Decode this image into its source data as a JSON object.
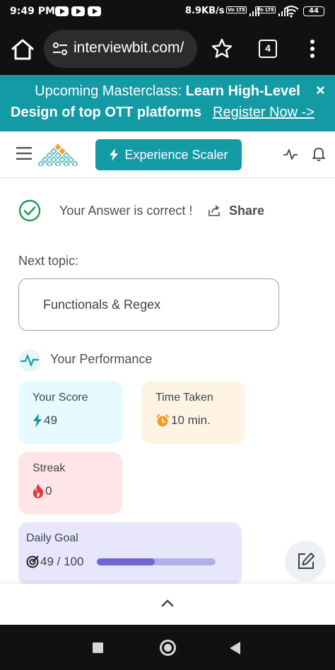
{
  "status_bar": {
    "time": "9:49 PM",
    "network_speed": "8.9KB/s",
    "sim1_tag": "Vo LTE",
    "sim2_tag": "Vo LTE",
    "battery": "44"
  },
  "browser": {
    "url": "interviewbit.com/",
    "tab_count": "4"
  },
  "banner": {
    "prefix": "Upcoming Masterclass: ",
    "highlight_1": "Learn High-Level",
    "highlight_2": "Design of top OTT platforms",
    "link_text": "Register Now ->",
    "close": "×",
    "background": "#139aa5"
  },
  "header": {
    "cta_label": "Experience Scaler",
    "accent": "#129aa5"
  },
  "result": {
    "message": "Your Answer is correct !",
    "share_label": "Share",
    "status_color": "#1f9d55"
  },
  "next_topic": {
    "label": "Next topic:",
    "title": "Functionals & Regex"
  },
  "performance": {
    "title": "Your Performance",
    "score": {
      "label": "Your Score",
      "value": "49",
      "icon": "bolt-icon"
    },
    "time": {
      "label": "Time Taken",
      "value": "10 min.",
      "icon": "alarm-clock-icon"
    },
    "streak": {
      "label": "Streak",
      "value": "0",
      "icon": "fire-icon"
    },
    "daily_goal": {
      "label": "Daily Goal",
      "value": "49 / 100",
      "progress_fraction": 0.49,
      "icon": "target-icon"
    }
  }
}
